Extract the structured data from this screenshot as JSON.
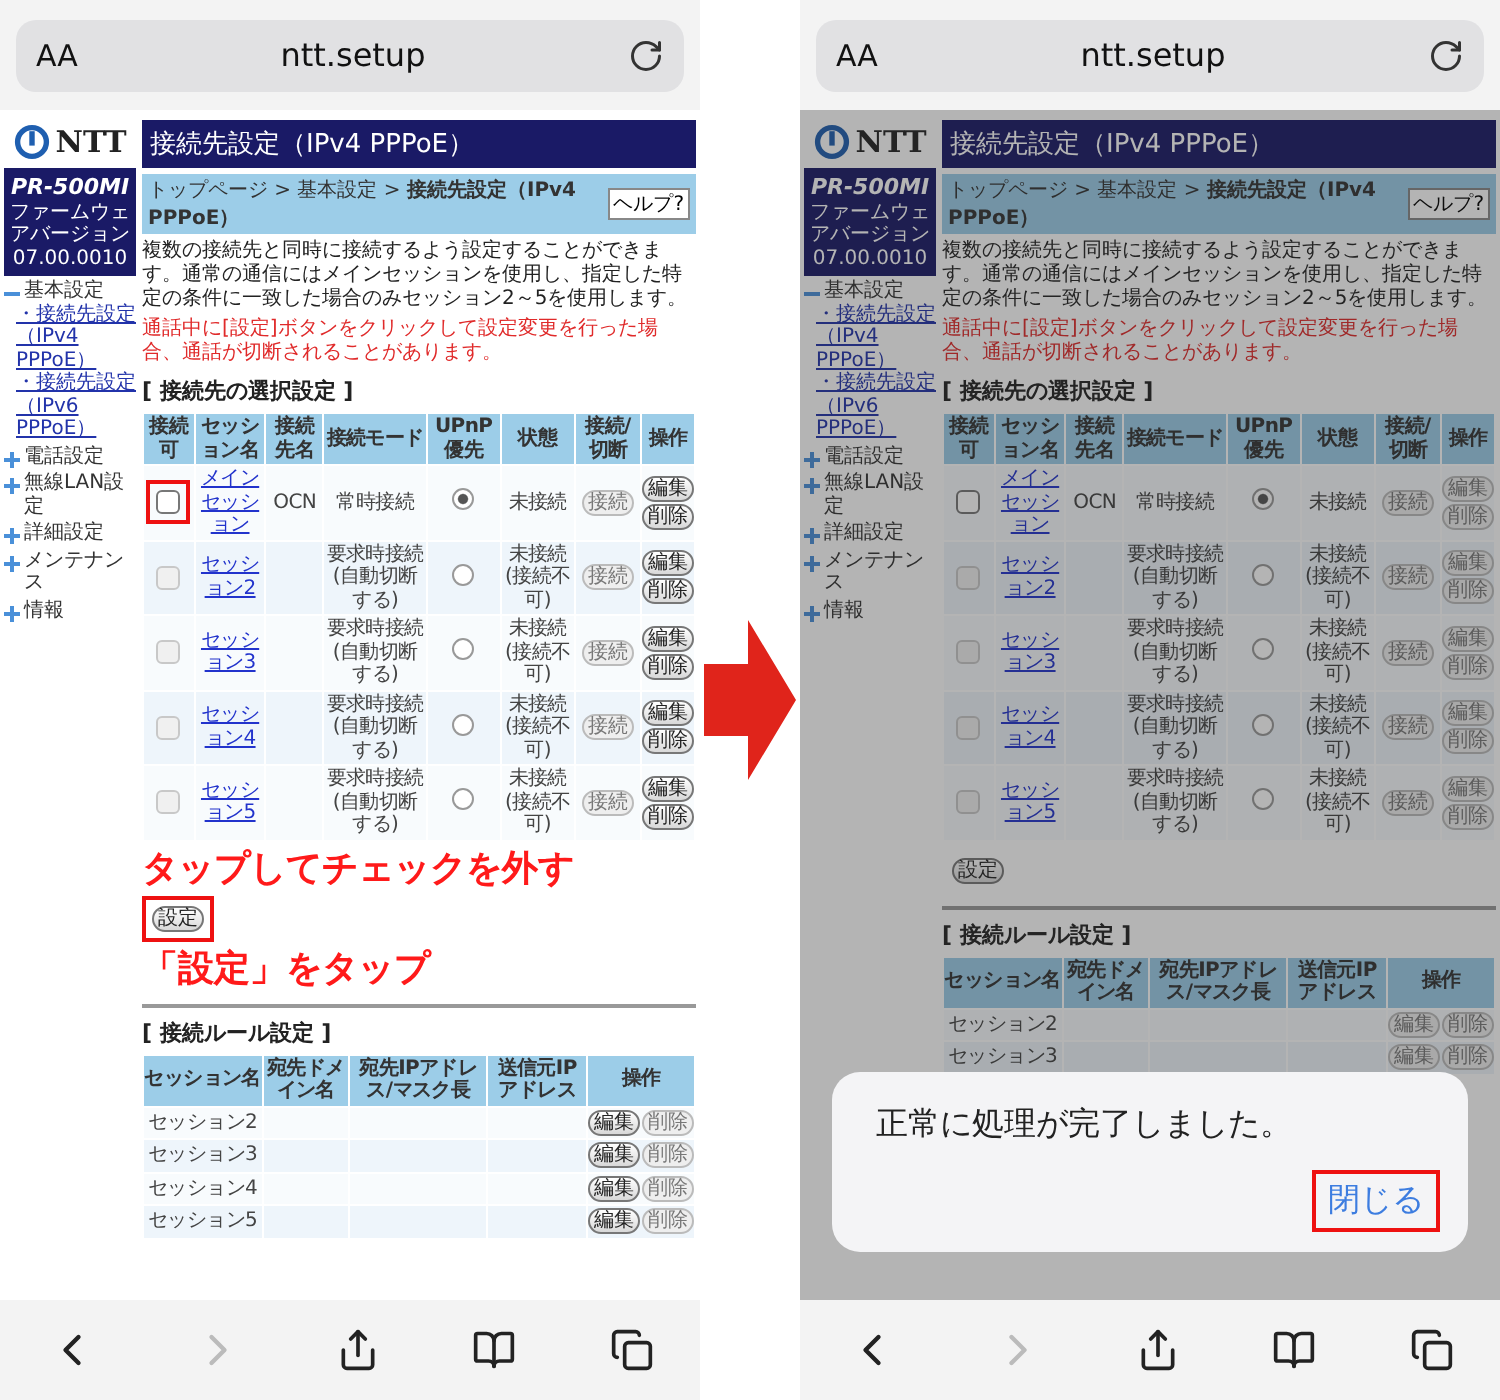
{
  "screens": [
    {
      "browser": {
        "text_size_button": "AA",
        "url": "ntt.setup",
        "forward_disabled": true
      },
      "page": {
        "logo_text": "NTT",
        "model": "PR-500MI",
        "firmware_label": "ファームウェアバージョン",
        "firmware_version": "07.00.0010",
        "sidebar": [
          {
            "label": "基本設定",
            "expanded": true,
            "children": [
              {
                "label": "・接続先設定（IPv4 PPPoE）"
              },
              {
                "label": "・接続先設定（IPv6 PPPoE）"
              }
            ]
          },
          {
            "label": "電話設定",
            "expanded": false
          },
          {
            "label": "無線LAN設定",
            "expanded": false
          },
          {
            "label": "詳細設定",
            "expanded": false
          },
          {
            "label": "メンテナンス",
            "expanded": false
          },
          {
            "label": "情報",
            "expanded": false
          }
        ],
        "title": "接続先設定（IPv4 PPPoE）",
        "breadcrumb": "トップページ > 基本設定 > **接続先設定（IPv4 PPPoE）**",
        "help": "ヘルプ?",
        "description": "複数の接続先と同時に接続するよう設定することができます。通常の通信にはメインセッションを使用し、指定した特定の条件に一致した場合のみセッション2～5を使用します。",
        "warning": "通話中に[設定]ボタンをクリックして設定変更を行った場合、通話が切断されることがあります。",
        "session_section": "[ 接続先の選択設定 ]",
        "session_table": {
          "columns": [
            "接続可",
            "セッション名",
            "接続先名",
            "接続モード",
            "UPnP優先",
            "状態",
            "接続/切断",
            "操作"
          ],
          "rows": [
            {
              "checked": false,
              "disabled": false,
              "highlighted": true,
              "name": "メインセッション",
              "provider": "OCN",
              "mode": "常時接続",
              "upnp": true,
              "status": "未接続",
              "connect": {
                "label": "接続",
                "disabled": true
              },
              "buttons": [
                {
                  "label": "編集",
                  "disabled": false
                },
                {
                  "label": "削除",
                  "disabled": false
                }
              ]
            },
            {
              "checked": false,
              "disabled": true,
              "highlighted": false,
              "name": "セッション2",
              "mode": "要求時接続(自動切断する)",
              "upnp": false,
              "status": "未接続(接続不可)",
              "connect": {
                "label": "接続",
                "disabled": true
              },
              "buttons": [
                {
                  "label": "編集",
                  "disabled": false
                },
                {
                  "label": "削除",
                  "disabled": false
                }
              ]
            },
            {
              "checked": false,
              "disabled": true,
              "highlighted": false,
              "name": "セッション3",
              "mode": "要求時接続(自動切断する)",
              "upnp": false,
              "status": "未接続(接続不可)",
              "connect": {
                "label": "接続",
                "disabled": true
              },
              "buttons": [
                {
                  "label": "編集",
                  "disabled": false
                },
                {
                  "label": "削除",
                  "disabled": false
                }
              ]
            },
            {
              "checked": false,
              "disabled": true,
              "highlighted": false,
              "name": "セッション4",
              "mode": "要求時接続(自動切断する)",
              "upnp": false,
              "status": "未接続(接続不可)",
              "connect": {
                "label": "接続",
                "disabled": true
              },
              "buttons": [
                {
                  "label": "編集",
                  "disabled": false
                },
                {
                  "label": "削除",
                  "disabled": false
                }
              ]
            },
            {
              "checked": false,
              "disabled": true,
              "highlighted": false,
              "name": "セッション5",
              "mode": "要求時接続(自動切断する)",
              "upnp": false,
              "status": "未接続(接続不可)",
              "connect": {
                "label": "接続",
                "disabled": true
              },
              "buttons": [
                {
                  "label": "編集",
                  "disabled": false
                },
                {
                  "label": "削除",
                  "disabled": false
                }
              ]
            }
          ]
        },
        "set_button": {
          "label": "設定",
          "highlighted": true
        },
        "rule_section": "[ 接続ルール設定 ]",
        "rule_table": {
          "columns": [
            "セッション名",
            "宛先ドメイン名",
            "宛先IPアドレス/マスク長",
            "送信元IPアドレス",
            "操作"
          ],
          "rows": [
            {
              "session": "セッション2",
              "buttons": [
                {
                  "label": "編集",
                  "disabled": false
                },
                {
                  "label": "削除",
                  "disabled": true
                }
              ]
            },
            {
              "session": "セッション3",
              "buttons": [
                {
                  "label": "編集",
                  "disabled": false
                },
                {
                  "label": "削除",
                  "disabled": true
                }
              ]
            },
            {
              "session": "セッション4",
              "buttons": [
                {
                  "label": "編集",
                  "disabled": false
                },
                {
                  "label": "削除",
                  "disabled": true
                }
              ]
            },
            {
              "session": "セッション5",
              "buttons": [
                {
                  "label": "編集",
                  "disabled": false
                },
                {
                  "label": "削除",
                  "disabled": true
                }
              ]
            }
          ]
        }
      },
      "callouts": [
        "タップしてチェックを外す",
        "「設定」をタップ"
      ],
      "dimmed": false
    },
    {
      "browser": {
        "text_size_button": "AA",
        "url": "ntt.setup",
        "forward_disabled": true
      },
      "page": {
        "logo_text": "NTT",
        "model": "PR-500MI",
        "firmware_label": "ファームウェアバージョン",
        "firmware_version": "07.00.0010",
        "sidebar": [
          {
            "label": "基本設定",
            "expanded": true,
            "children": [
              {
                "label": "・接続先設定（IPv4 PPPoE）"
              },
              {
                "label": "・接続先設定（IPv6 PPPoE）"
              }
            ]
          },
          {
            "label": "電話設定",
            "expanded": false
          },
          {
            "label": "無線LAN設定",
            "expanded": false
          },
          {
            "label": "詳細設定",
            "expanded": false
          },
          {
            "label": "メンテナンス",
            "expanded": false
          },
          {
            "label": "情報",
            "expanded": false
          }
        ],
        "title": "接続先設定（IPv4 PPPoE）",
        "breadcrumb": "トップページ > 基本設定 > **接続先設定（IPv4 PPPoE）**",
        "help": "ヘルプ?",
        "description": "複数の接続先と同時に接続するよう設定することができます。通常の通信にはメインセッションを使用し、指定した特定の条件に一致した場合のみセッション2～5を使用します。",
        "warning": "通話中に[設定]ボタンをクリックして設定変更を行った場合、通話が切断されることがあります。",
        "session_section": "[ 接続先の選択設定 ]",
        "session_table": {
          "columns": [
            "接続可",
            "セッション名",
            "接続先名",
            "接続モード",
            "UPnP優先",
            "状態",
            "接続/切断",
            "操作"
          ],
          "rows": [
            {
              "checked": false,
              "disabled": false,
              "highlighted": false,
              "name": "メインセッション",
              "provider": "OCN",
              "mode": "常時接続",
              "upnp": true,
              "status": "未接続",
              "connect": {
                "label": "接続",
                "disabled": true
              },
              "buttons": [
                {
                  "label": "編集",
                  "disabled": true
                },
                {
                  "label": "削除",
                  "disabled": true
                }
              ]
            },
            {
              "checked": false,
              "disabled": true,
              "highlighted": false,
              "name": "セッション2",
              "mode": "要求時接続(自動切断する)",
              "upnp": false,
              "status": "未接続(接続不可)",
              "connect": {
                "label": "接続",
                "disabled": true
              },
              "buttons": [
                {
                  "label": "編集",
                  "disabled": true
                },
                {
                  "label": "削除",
                  "disabled": true
                }
              ]
            },
            {
              "checked": false,
              "disabled": true,
              "highlighted": false,
              "name": "セッション3",
              "mode": "要求時接続(自動切断する)",
              "upnp": false,
              "status": "未接続(接続不可)",
              "connect": {
                "label": "接続",
                "disabled": true
              },
              "buttons": [
                {
                  "label": "編集",
                  "disabled": true
                },
                {
                  "label": "削除",
                  "disabled": true
                }
              ]
            },
            {
              "checked": false,
              "disabled": true,
              "highlighted": false,
              "name": "セッション4",
              "mode": "要求時接続(自動切断する)",
              "upnp": false,
              "status": "未接続(接続不可)",
              "connect": {
                "label": "接続",
                "disabled": true
              },
              "buttons": [
                {
                  "label": "編集",
                  "disabled": true
                },
                {
                  "label": "削除",
                  "disabled": true
                }
              ]
            },
            {
              "checked": false,
              "disabled": true,
              "highlighted": false,
              "name": "セッション5",
              "mode": "要求時接続(自動切断する)",
              "upnp": false,
              "status": "未接続(接続不可)",
              "connect": {
                "label": "接続",
                "disabled": true
              },
              "buttons": [
                {
                  "label": "編集",
                  "disabled": true
                },
                {
                  "label": "削除",
                  "disabled": true
                }
              ]
            }
          ]
        },
        "set_button": {
          "label": "設定",
          "highlighted": false
        },
        "rule_section": "[ 接続ルール設定 ]",
        "rule_table": {
          "columns": [
            "セッション名",
            "宛先ドメイン名",
            "宛先IPアドレス/マスク長",
            "送信元IPアドレス",
            "操作"
          ],
          "rows": [
            {
              "session": "セッション2",
              "buttons": [
                {
                  "label": "編集",
                  "disabled": true
                },
                {
                  "label": "削除",
                  "disabled": true
                }
              ]
            },
            {
              "session": "セッション3",
              "buttons": [
                {
                  "label": "編集",
                  "disabled": true
                },
                {
                  "label": "削除",
                  "disabled": true
                }
              ]
            }
          ]
        }
      },
      "dimmed": true,
      "dialog": {
        "message": "正常に処理が完了しました。",
        "button": {
          "label": "閉じる",
          "highlighted": true
        }
      }
    }
  ]
}
